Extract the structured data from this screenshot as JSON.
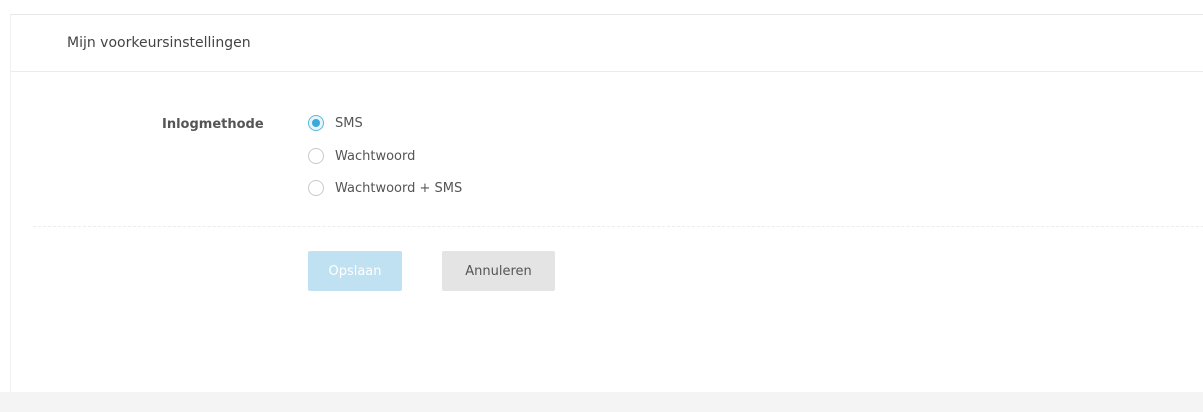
{
  "panel": {
    "title": "Mijn voorkeursinstellingen"
  },
  "form": {
    "login_method_label": "Inlogmethode",
    "options": [
      {
        "label": "SMS",
        "checked": true
      },
      {
        "label": "Wachtwoord",
        "checked": false
      },
      {
        "label": "Wachtwoord + SMS",
        "checked": false
      }
    ]
  },
  "actions": {
    "save_label": "Opslaan",
    "cancel_label": "Annuleren"
  },
  "colors": {
    "accent": "#3aa8da",
    "save_button_disabled": "#bfe1f2",
    "cancel_button": "#e4e4e4"
  }
}
